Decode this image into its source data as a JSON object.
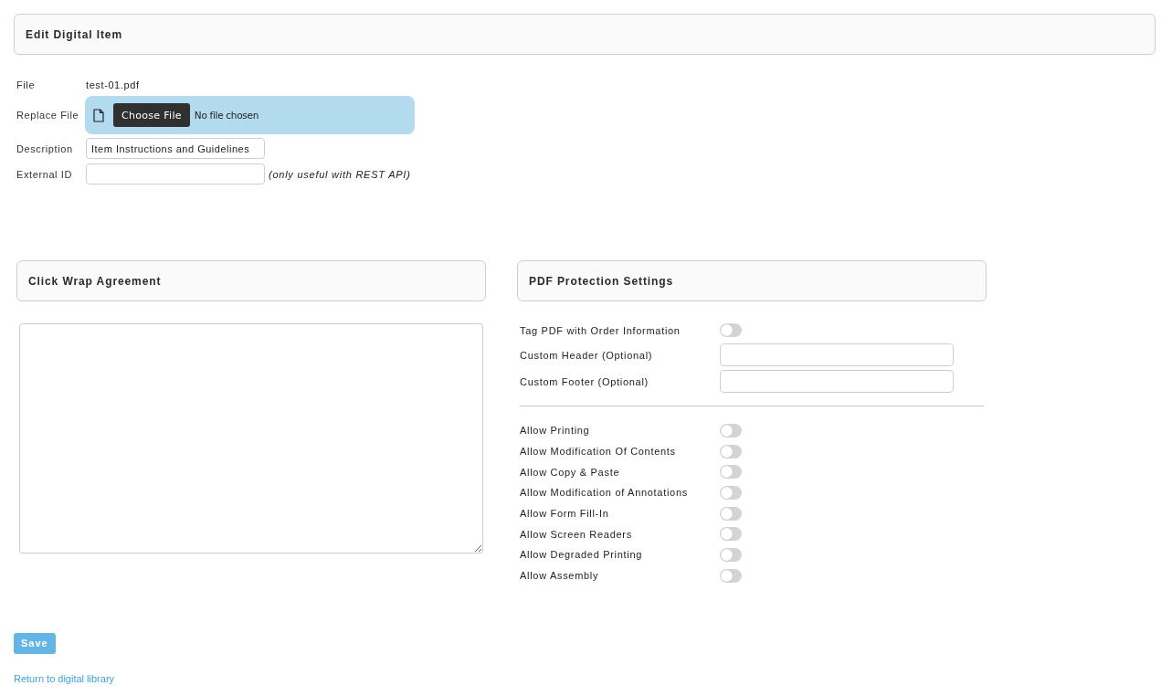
{
  "header": {
    "title": "Edit Digital Item"
  },
  "item_form": {
    "rows": [
      {
        "kind": "text",
        "label": "File",
        "value": "test-01.pdf"
      },
      {
        "kind": "file",
        "label": "Replace File",
        "button": "Choose File",
        "status": "No file chosen"
      },
      {
        "kind": "input",
        "label": "Description",
        "value": "Item Instructions and Guidelines"
      },
      {
        "kind": "input",
        "label": "External ID",
        "note": "(only useful with REST API)"
      }
    ]
  },
  "click_wrap": {
    "title": "Click Wrap Agreement"
  },
  "pdf_protection": {
    "title": "PDF Protection Settings",
    "settings": [
      {
        "kind": "toggle",
        "label": "Tag PDF with Order Information",
        "on": false
      },
      {
        "kind": "input",
        "label": "Custom Header (Optional)"
      },
      {
        "kind": "input",
        "label": "Custom Footer (Optional)"
      }
    ],
    "permissions": [
      {
        "label": "Allow Printing",
        "on": false
      },
      {
        "label": "Allow Modification Of Contents",
        "on": false
      },
      {
        "label": "Allow Copy & Paste",
        "on": false
      },
      {
        "label": "Allow Modification of Annotations",
        "on": false
      },
      {
        "label": "Allow Form Fill-In",
        "on": false
      },
      {
        "label": "Allow Screen Readers",
        "on": false
      },
      {
        "label": "Allow Degraded Printing",
        "on": false
      },
      {
        "label": "Allow Assembly",
        "on": false
      }
    ]
  },
  "save_button": "Save",
  "return_link": "Return to digital library"
}
